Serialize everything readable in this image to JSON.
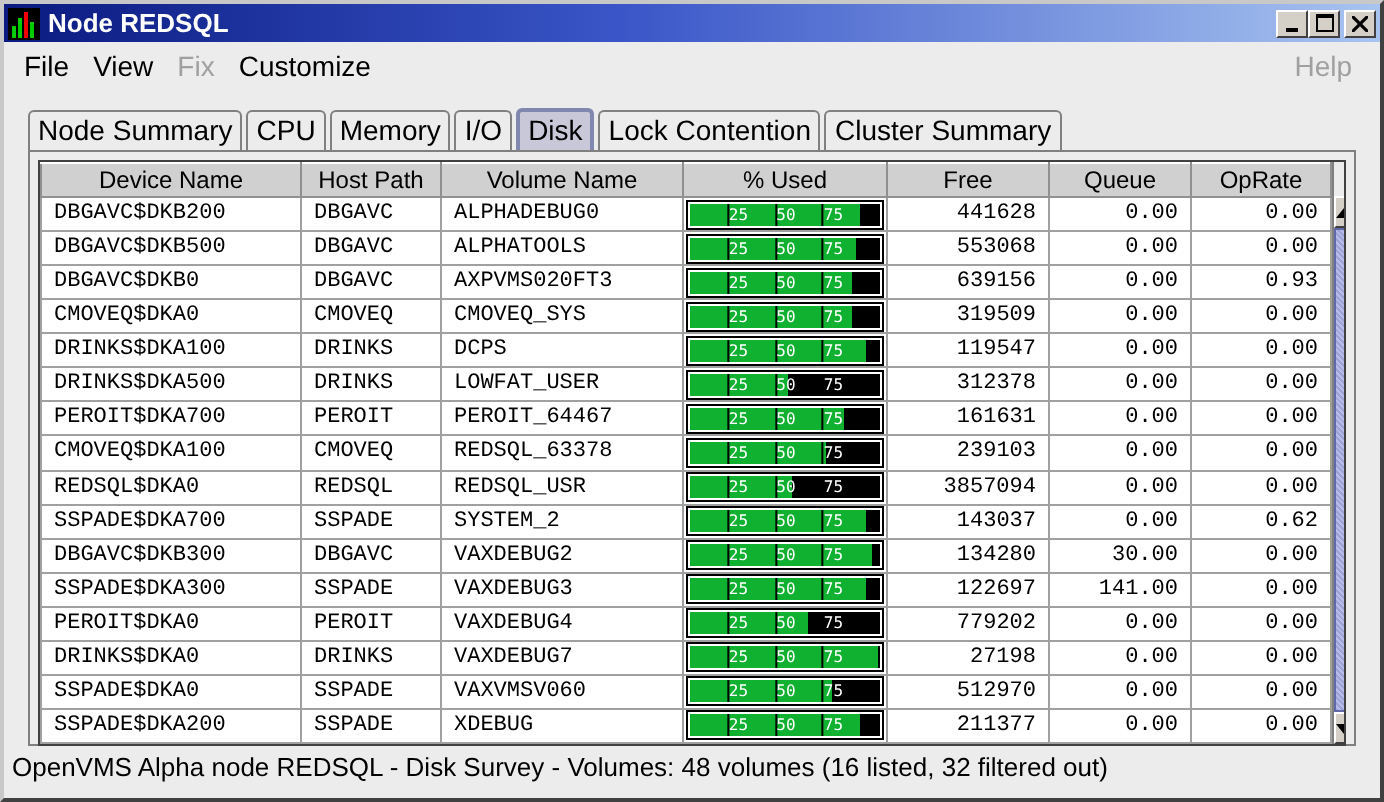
{
  "window": {
    "title": "Node REDSQL"
  },
  "menu": [
    {
      "label": "File",
      "disabled": false
    },
    {
      "label": "View",
      "disabled": false
    },
    {
      "label": "Fix",
      "disabled": true
    },
    {
      "label": "Customize",
      "disabled": false
    },
    {
      "label": "Help",
      "disabled": true
    }
  ],
  "tabs": [
    {
      "label": "Node Summary",
      "selected": false
    },
    {
      "label": "CPU",
      "selected": false
    },
    {
      "label": "Memory",
      "selected": false
    },
    {
      "label": "I/O",
      "selected": false
    },
    {
      "label": "Disk",
      "selected": true
    },
    {
      "label": "Lock Contention",
      "selected": false
    },
    {
      "label": "Cluster Summary",
      "selected": false
    }
  ],
  "table": {
    "columns": [
      "Device Name",
      "Host Path",
      "Volume Name",
      "% Used",
      "Free",
      "Queue",
      "OpRate"
    ],
    "rows": [
      {
        "device": "DBGAVC$DKB200",
        "host": "DBGAVC",
        "volume": "ALPHADEBUG0",
        "level": 0.89,
        "ticks": [
          "25",
          "50",
          "75"
        ],
        "free": "441628",
        "queue": "0.00",
        "oprate": "0.00"
      },
      {
        "device": "DBGAVC$DKB500",
        "host": "DBGAVC",
        "volume": "ALPHATOOLS",
        "level": 0.87,
        "ticks": [
          "25",
          "50",
          "75"
        ],
        "free": "553068",
        "queue": "0.00",
        "oprate": "0.00"
      },
      {
        "device": "DBGAVC$DKB0",
        "host": "DBGAVC",
        "volume": "AXPVMS020FT3",
        "level": 0.85,
        "ticks": [
          "25",
          "50",
          "75"
        ],
        "free": "639156",
        "queue": "0.00",
        "oprate": "0.93"
      },
      {
        "device": "CMOVEQ$DKA0",
        "host": "CMOVEQ",
        "volume": "CMOVEQ_SYS",
        "level": 0.85,
        "ticks": [
          "25",
          "50",
          "75"
        ],
        "free": "319509",
        "queue": "0.00",
        "oprate": "0.00"
      },
      {
        "device": "DRINKS$DKA100",
        "host": "DRINKS",
        "volume": "DCPS",
        "level": 0.93,
        "ticks": [
          "25",
          "50",
          "75"
        ],
        "free": "119547",
        "queue": "0.00",
        "oprate": "0.00"
      },
      {
        "device": "DRINKS$DKA500",
        "host": "DRINKS",
        "volume": "LOWFAT_USER",
        "level": 0.52,
        "ticks": [
          "25",
          "50",
          "75"
        ],
        "free": "312378",
        "queue": "0.00",
        "oprate": "0.00"
      },
      {
        "device": "PEROIT$DKA700",
        "host": "PEROIT",
        "volume": "PEROIT_64467",
        "level": 0.81,
        "ticks": [
          "25",
          "50",
          "75"
        ],
        "free": "161631",
        "queue": "0.00",
        "oprate": "0.00"
      },
      {
        "device": "CMOVEQ$DKA100",
        "host": "CMOVEQ",
        "volume": "REDSQL_63378",
        "level": 0.72,
        "ticks": [
          "25",
          "50",
          "75"
        ],
        "free": "239103",
        "queue": "0.00",
        "oprate": "0.00"
      },
      {
        "device": "REDSQL$DKA0",
        "host": "REDSQL",
        "volume": "REDSQL_USR",
        "level": 0.54,
        "ticks": [
          "25",
          "50",
          "75"
        ],
        "free": "3857094",
        "queue": "0.00",
        "oprate": "0.00"
      },
      {
        "device": "SSPADE$DKA700",
        "host": "SSPADE",
        "volume": "SYSTEM_2",
        "level": 0.93,
        "ticks": [
          "25",
          "50",
          "75"
        ],
        "free": "143037",
        "queue": "0.00",
        "oprate": "0.62"
      },
      {
        "device": "DBGAVC$DKB300",
        "host": "DBGAVC",
        "volume": "VAXDEBUG2",
        "level": 0.96,
        "ticks": [
          "25",
          "50",
          "75"
        ],
        "free": "134280",
        "queue": "30.00",
        "oprate": "0.00"
      },
      {
        "device": "SSPADE$DKA300",
        "host": "SSPADE",
        "volume": "VAXDEBUG3",
        "level": 0.93,
        "ticks": [
          "25",
          "50",
          "75"
        ],
        "free": "122697",
        "queue": "141.00",
        "oprate": "0.00"
      },
      {
        "device": "PEROIT$DKA0",
        "host": "PEROIT",
        "volume": "VAXDEBUG4",
        "level": 0.62,
        "ticks": [
          "25",
          "50",
          "75"
        ],
        "free": "779202",
        "queue": "0.00",
        "oprate": "0.00"
      },
      {
        "device": "DRINKS$DKA0",
        "host": "DRINKS",
        "volume": "VAXDEBUG7",
        "level": 0.99,
        "ticks": [
          "25",
          "50",
          "75"
        ],
        "free": "27198",
        "queue": "0.00",
        "oprate": "0.00"
      },
      {
        "device": "SSPADE$DKA0",
        "host": "SSPADE",
        "volume": "VAXVMSV060",
        "level": 0.75,
        "ticks": [
          "25",
          "50",
          "75"
        ],
        "free": "512970",
        "queue": "0.00",
        "oprate": "0.00"
      },
      {
        "device": "SSPADE$DKA200",
        "host": "SSPADE",
        "volume": "XDEBUG",
        "level": 0.89,
        "ticks": [
          "25",
          "50",
          "75"
        ],
        "free": "211377",
        "queue": "0.00",
        "oprate": "0.00"
      }
    ]
  },
  "status_bar": "OpenVMS Alpha node REDSQL - Disk Survey - Volumes:  48 volumes (16 listed, 32 filtered out)"
}
